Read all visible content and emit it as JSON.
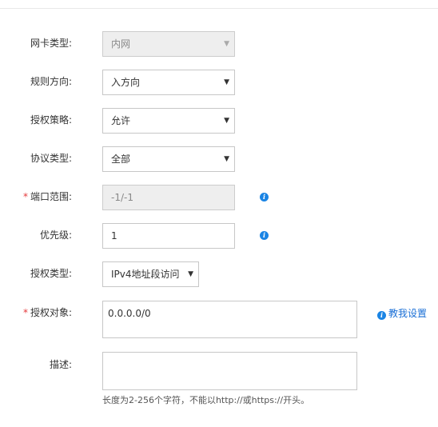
{
  "form": {
    "nic_type": {
      "label": "网卡类型:",
      "value": "内网"
    },
    "direction": {
      "label": "规则方向:",
      "value": "入方向"
    },
    "policy": {
      "label": "授权策略:",
      "value": "允许"
    },
    "protocol": {
      "label": "协议类型:",
      "value": "全部"
    },
    "port_range": {
      "label": "端口范围:",
      "required_mark": "*",
      "value": "-1/-1"
    },
    "priority": {
      "label": "优先级:",
      "value": "1"
    },
    "auth_type": {
      "label": "授权类型:",
      "value": "IPv4地址段访问"
    },
    "auth_object": {
      "label": "授权对象:",
      "required_mark": "*",
      "value": "0.0.0.0/0",
      "help_link": "教我设置"
    },
    "description": {
      "label": "描述:",
      "value": "",
      "hint": "长度为2-256个字符，不能以http://或https://开头。"
    }
  },
  "icons": {
    "caret": "caret-down-icon",
    "info": "info-icon"
  },
  "colors": {
    "accent": "#1a84e4",
    "required": "#e4393c",
    "disabled_bg": "#eeeeee"
  }
}
